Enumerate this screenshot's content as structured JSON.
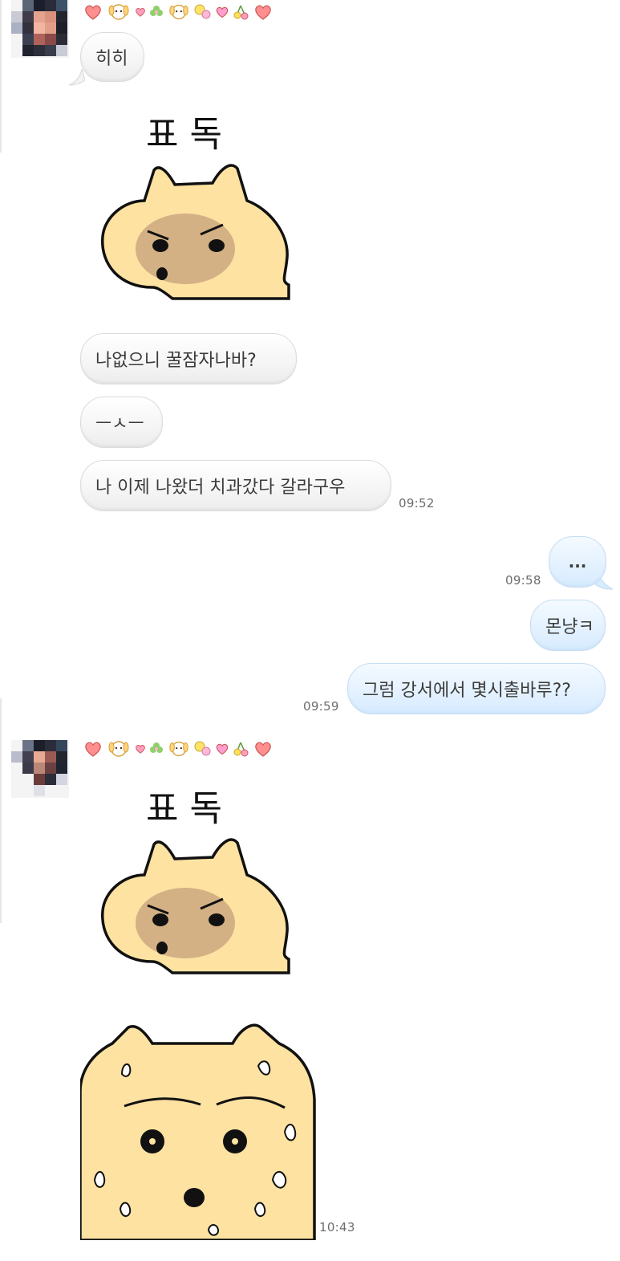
{
  "messages": [
    {
      "side": "in",
      "type": "text",
      "text": "히히"
    },
    {
      "side": "in",
      "type": "sticker",
      "sticker_text": "표 독"
    },
    {
      "side": "in",
      "type": "text",
      "text": "나없으니 꿀잠자나바?"
    },
    {
      "side": "in",
      "type": "text",
      "text": "ㅡㅅㅡ"
    },
    {
      "side": "in",
      "type": "text",
      "text": "나 이제 나왔더 치과갔다 갈라구우",
      "time": "09:52"
    },
    {
      "side": "out",
      "type": "text",
      "text": "...",
      "time": "09:58"
    },
    {
      "side": "out",
      "type": "text",
      "text": "몬냥ㅋ"
    },
    {
      "side": "out",
      "type": "text",
      "text": "그럼 강서에서 몇시출바루??",
      "time": "09:59"
    },
    {
      "side": "in",
      "type": "sticker",
      "sticker_text": "표 독"
    },
    {
      "side": "in",
      "type": "sticker",
      "sticker_text": "",
      "time": "10:43"
    }
  ],
  "sender": {
    "nickname_icons": [
      "heart-icon",
      "puppy-icon",
      "heart-icon",
      "clover-icon",
      "puppy-icon",
      "balloon-icon",
      "heart-icon",
      "cherry-icon",
      "heart-icon"
    ]
  },
  "colors": {
    "incoming_bubble": "#f2f2f2",
    "outgoing_bubble": "#e0f0ff",
    "sticker_cat": "#fde2a2",
    "sticker_face": "#d3b184"
  }
}
